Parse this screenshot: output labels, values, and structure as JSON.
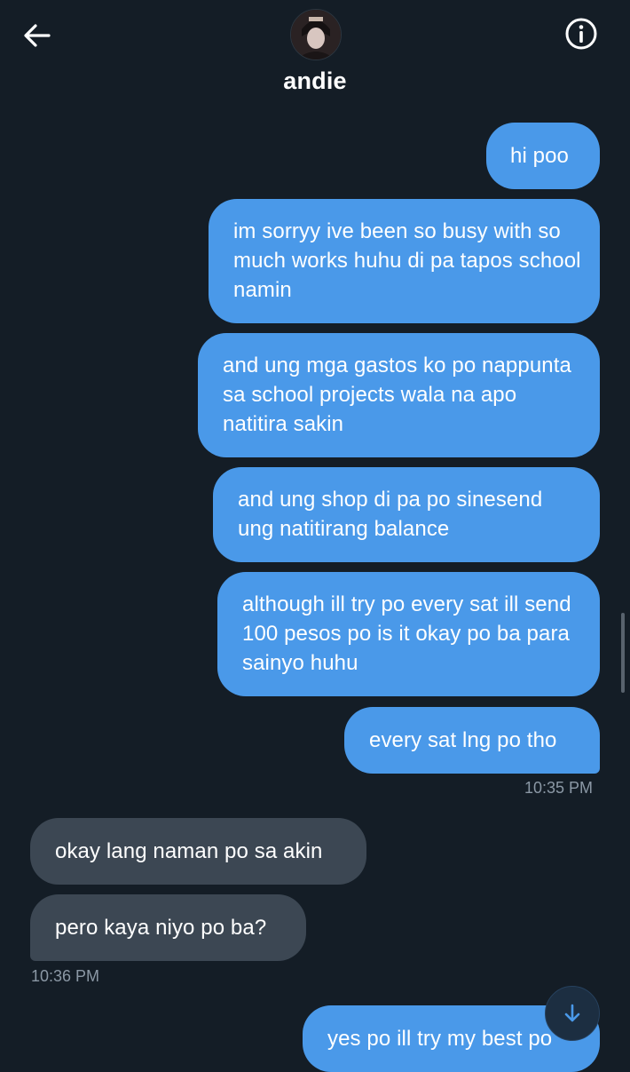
{
  "header": {
    "contact_name": "andie",
    "back_icon": "arrow-left-icon",
    "info_icon": "info-circle-icon"
  },
  "messages": [
    {
      "dir": "out",
      "text": "hi poo"
    },
    {
      "dir": "out",
      "text": "im sorryy ive been so busy with so much works huhu di pa tapos school namin"
    },
    {
      "dir": "out",
      "text": "and ung mga gastos ko po nappunta sa school projects wala na apo natitira sakin"
    },
    {
      "dir": "out",
      "text": "and ung shop di pa po sinesend ung natitirang balance"
    },
    {
      "dir": "out",
      "text": "although ill try po every sat ill send 100 pesos po is it okay po ba para sainyo huhu"
    },
    {
      "dir": "out",
      "text": "every sat lng po tho"
    },
    {
      "dir": "in",
      "text": "okay lang naman po sa akin"
    },
    {
      "dir": "in",
      "text": "pero kaya niyo po ba?"
    },
    {
      "dir": "out",
      "text": "yes po ill try my best po"
    }
  ],
  "timestamps": {
    "out_group": "10:35 PM",
    "in_group": "10:36 PM"
  },
  "colors": {
    "background": "#141d26",
    "outgoing_bubble": "#4a99e9",
    "incoming_bubble": "#3c4753",
    "timestamp": "#8b98a5"
  },
  "scroll_down_icon": "arrow-down-icon"
}
